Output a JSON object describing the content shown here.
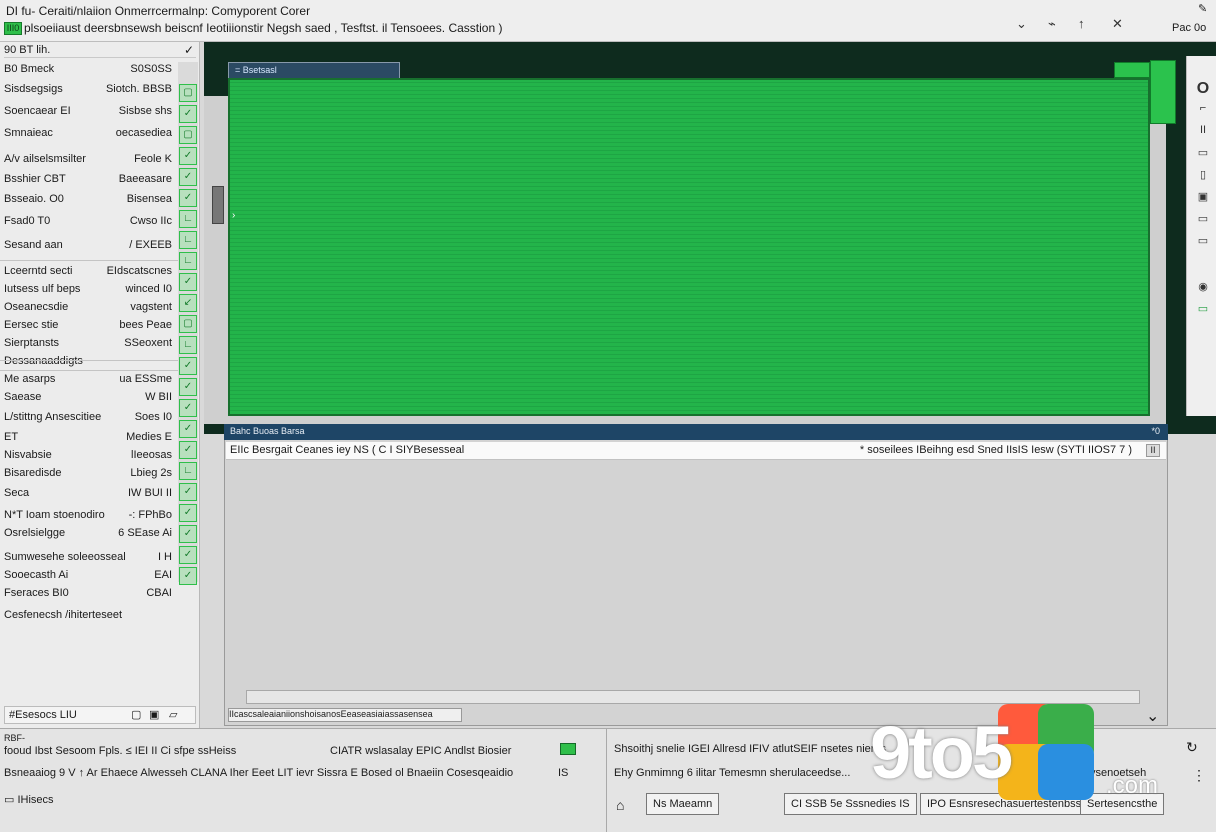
{
  "titlebar": {
    "line1": "DI fu- Ceraiti/nlaiion Onmerrcermalnp: Comyporent Corer",
    "line2": "plsoeiiaust deersbnsewsh beiscnf Ieotiiionstir Negsh saed , Tesftst. il Tensoees. Casstion )",
    "badge": "III0",
    "win_controls": [
      "⌄",
      "⌁",
      "↑",
      "✕"
    ],
    "right_top": "✎",
    "right_bottom": "Pac 0o"
  },
  "left_panel": {
    "header": "90 BT lih.",
    "rows": [
      {
        "a": "B0 Bmeck",
        "b": "S0S0SS"
      },
      {
        "a": "Sisdsegsigs",
        "b": "Siotch. BBSB"
      },
      {
        "a": "Soencaear  EI",
        "b": "Sisbse shs"
      },
      {
        "a": "Smnaieac",
        "b": "oecasediea"
      },
      {
        "a": "A/v ailselsmsilter",
        "b": "Feole K"
      },
      {
        "a": "Bsshier CBT",
        "b": "Baeeasare"
      },
      {
        "a": "Bsseaio. O0",
        "b": "Bisensea"
      },
      {
        "a": "Fsad0 T0",
        "b": "Cwso IIc"
      },
      {
        "a": "Sesand aan",
        "b": "/ EXEEB"
      },
      {
        "a": "Lceerntd secti",
        "b": "EIdscatscnes"
      },
      {
        "a": "Iutsess ulf beps",
        "b": "winced I0"
      },
      {
        "a": "Oseanecsdie",
        "b": "vagstent"
      },
      {
        "a": "Eersec stie",
        "b": "bees Peae"
      },
      {
        "a": "Sierptansts",
        "b": "SSeoxent"
      },
      {
        "a": "Dessanaaddigts",
        "b": ""
      },
      {
        "a": "Me asarps",
        "b": "ua ESSme"
      },
      {
        "a": "Saease",
        "b": "W BII"
      },
      {
        "a": "L/stittng Ansescitiee",
        "b": "Soes I0"
      },
      {
        "a": "ET",
        "b": "Medies E"
      },
      {
        "a": "Nisvabsie",
        "b": "lIeeosas"
      },
      {
        "a": "Bisaredisde",
        "b": "Lbieg 2s"
      },
      {
        "a": "Seca",
        "b": "IW BUI II"
      },
      {
        "a": "N*T Ioam stoenodiro",
        "b": "-: FPhBo"
      },
      {
        "a": "Osrelsielgge",
        "b": "6 SEase Ai"
      },
      {
        "a": "Sumwesehe soleeosseal",
        "b": "I  H"
      },
      {
        "a": "Sooecasth Ai",
        "b": "EAI"
      },
      {
        "a": "Fseraces BI0",
        "b": "CBAI"
      },
      {
        "a": "Cesfenecsh /ihiterteseet",
        "b": ""
      }
    ],
    "green_boxes": [
      "▢",
      "✓",
      "▢",
      "✓",
      "✓",
      "✓",
      "∟",
      "∟",
      "∟",
      "✓",
      "↙",
      "▢",
      "∟",
      "✓",
      "✓",
      "✓",
      "✓",
      "✓",
      "∟",
      "✓",
      "✓",
      "✓",
      "✓",
      "✓"
    ],
    "footer_label": "#Esesocs LIU",
    "footer_icons": [
      "▢",
      "▣",
      "▱"
    ]
  },
  "main": {
    "tab_label": "= Bsetsasl",
    "arrow_marker": "›",
    "right_tools": [
      "O",
      "⌐",
      "II",
      "▭",
      "▯",
      "▣",
      "▭",
      "▭",
      "◉",
      "▭"
    ]
  },
  "lower_panel": {
    "header": "Bahc Buoas Barsa",
    "header_right": "*0",
    "path_left": "EIIc Besrgait Ceanes iey NS ( C I SIYBesesseal",
    "path_right": "* soseilees IBeihng esd Sned IIsIS Iesw (SYTI IIOS7 7 )",
    "path_button": "II",
    "footer_path": "IIcascsaleaianiionshoisanosEeaseasiaiassasensea",
    "chevron": "⌄"
  },
  "bottom": {
    "row1_left": "RBF-",
    "row1": "fooud Ibst Sesoom Fpls.  ≤ IEI II  Ci  sfpe ssHeiss",
    "row1_mid": "CIATR  wslasalay EPIC Andlst Biosier",
    "row2": "Bsneaaiog 9  V  ↑  Ar Ehaece Alwesseh CLANA Iher Eeet LIT ievr Sissra  E Bosed ol Bnaeiin Cosesqeaidio",
    "row2_btn": "IS",
    "row3": "IHisecs",
    "right1": "Shsoithj snelie IGEI  Allresd IFIV atlutSEIF nsetes nieres",
    "right2": "Ehy Gnmimng 6 ilitar Temesmn sherulaceedse...",
    "btn_a": "Ns Maeamn",
    "btn_b": "CI SSB 5e Sssnedies IS",
    "btn_c": "IPO Esnsresechasuertestenbss",
    "btn_d": "Sertesencsthe",
    "btn_e": "vsenoetseh",
    "icons": [
      "⌂",
      "↻",
      "⋮"
    ]
  },
  "watermark": {
    "text": "9to5",
    "suffix": ".com"
  }
}
